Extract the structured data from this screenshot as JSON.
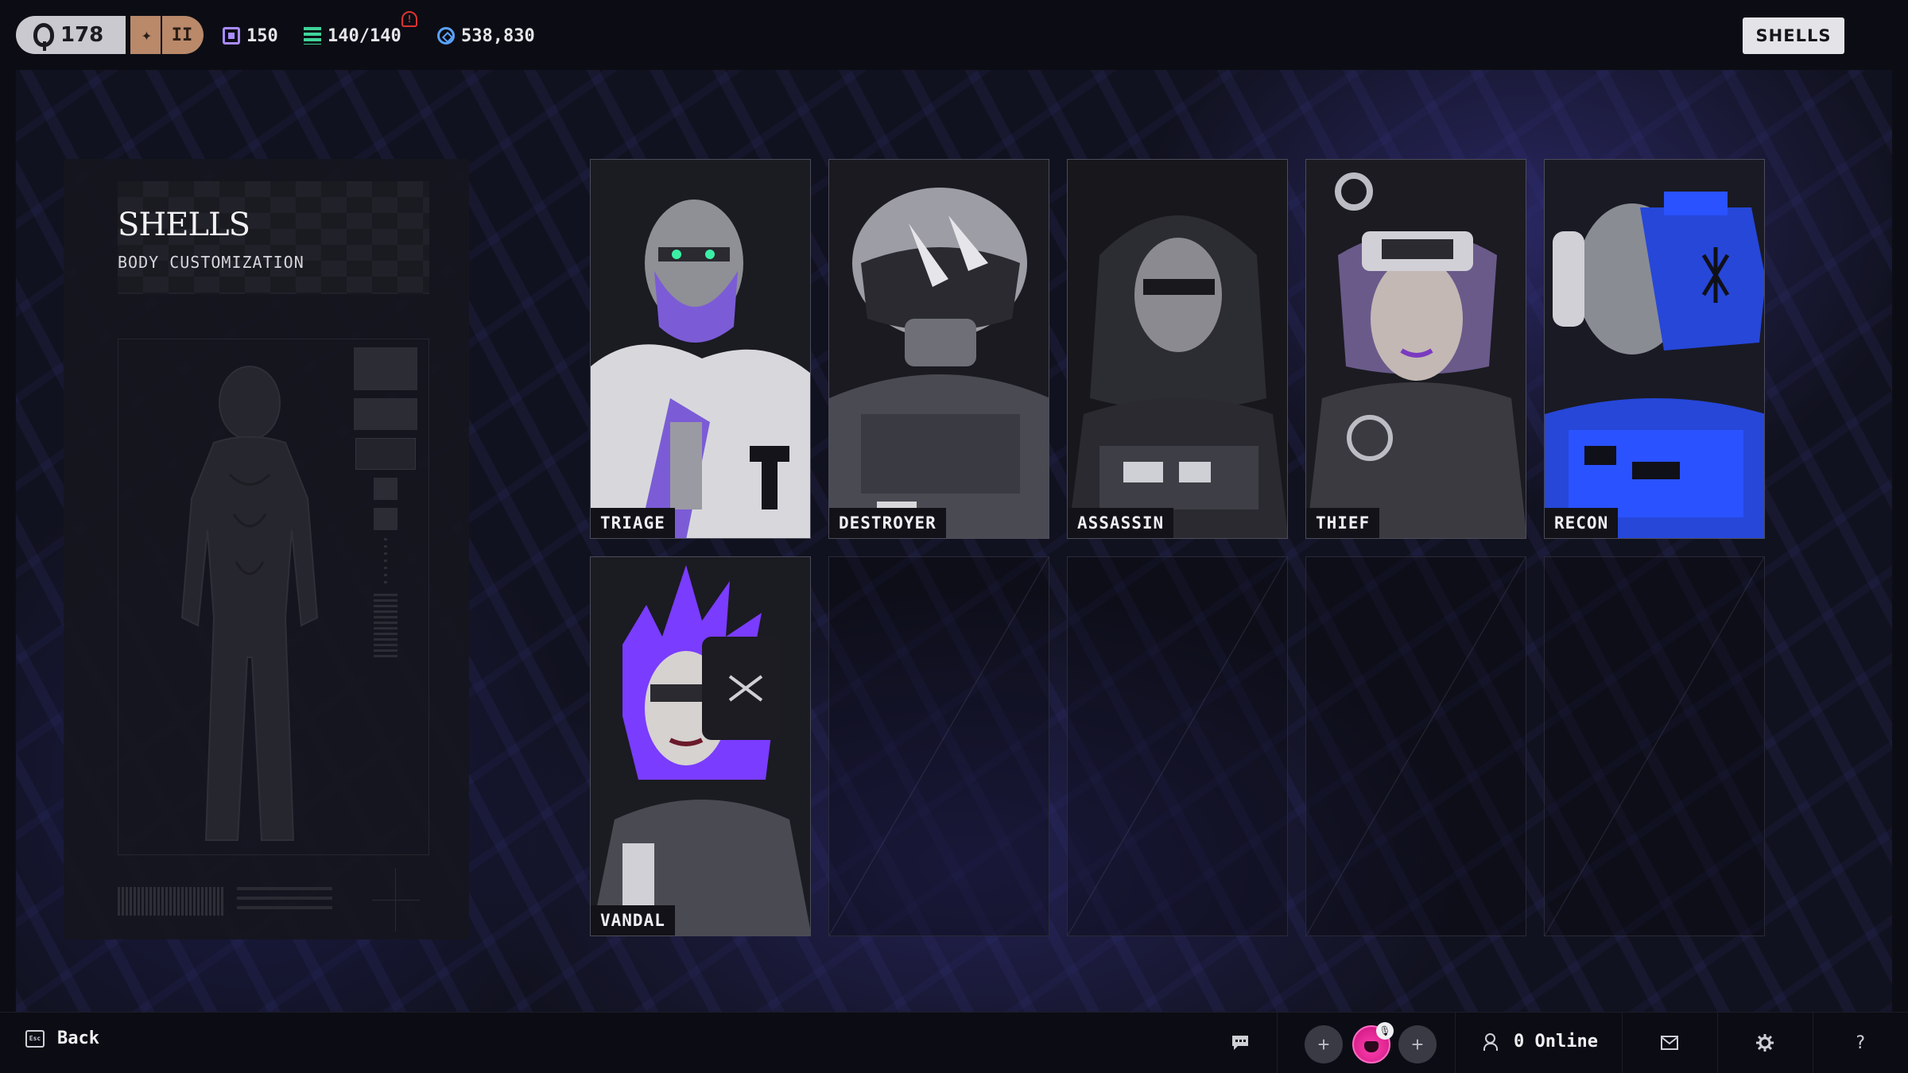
{
  "topbar": {
    "level": "178",
    "rank_numeral": "II",
    "tokens": "150",
    "capacity": "140/140",
    "alert_mark": "!",
    "credits": "538,830",
    "shells_button": "SHELLS"
  },
  "panel": {
    "title": "SHELLS",
    "subtitle": "BODY CUSTOMIZATION"
  },
  "shells": [
    {
      "name": "TRIAGE",
      "accent": "#7b5cd6"
    },
    {
      "name": "DESTROYER",
      "accent": "#bdbdc4"
    },
    {
      "name": "ASSASSIN",
      "accent": "#5a5a62"
    },
    {
      "name": "THIEF",
      "accent": "#8a6fbf"
    },
    {
      "name": "RECON",
      "accent": "#2647d8"
    },
    {
      "name": "VANDAL",
      "accent": "#7a3cff"
    }
  ],
  "bottombar": {
    "back_label": "Back",
    "esc_key": "Esc",
    "online": "0 Online",
    "party_empty_glyph": "+",
    "help_glyph": "?"
  },
  "colors": {
    "background": "#0c0d14",
    "stage_tint": "#2a2a7a",
    "shells_button_bg": "#e4e4e8",
    "party_me": "#ff3fb0"
  }
}
